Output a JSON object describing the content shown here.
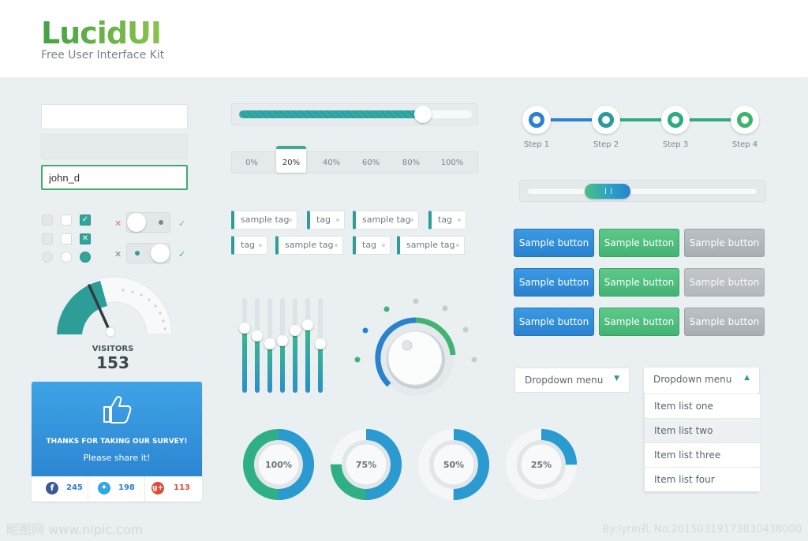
{
  "brand": {
    "logo_text": "LucidUI",
    "tagline": "Free User Interface Kit"
  },
  "inputs": {
    "empty_value": "",
    "disabled_value": "",
    "active_value": "john_d"
  },
  "progress": {
    "fill_fraction": 0.79
  },
  "segments": {
    "labels": [
      "0%",
      "20%",
      "40%",
      "60%",
      "80%",
      "100%"
    ],
    "selected": "20%"
  },
  "tags": {
    "row1": [
      "sample tag",
      "tag",
      "sample tag",
      "tag"
    ],
    "row2": [
      "tag",
      "sample tag",
      "tag",
      "sample tag"
    ]
  },
  "stepper": {
    "steps": [
      "Step 1",
      "Step 2",
      "Step 3",
      "Step 4"
    ]
  },
  "range_slider": {
    "low": 0.25,
    "high": 0.45
  },
  "buttons": {
    "label": "Sample button"
  },
  "gauge": {
    "label": "VISITORS",
    "value": "153"
  },
  "survey": {
    "title": "THANKS FOR TAKING OUR SURVEY!",
    "subtitle": "Please share it!",
    "facebook": "245",
    "twitter": "198",
    "googleplus": "113"
  },
  "equalizer": {
    "levels": [
      0.68,
      0.6,
      0.52,
      0.55,
      0.66,
      0.72,
      0.52
    ]
  },
  "donuts": [
    {
      "label": "100%",
      "value": 100
    },
    {
      "label": "75%",
      "value": 75
    },
    {
      "label": "50%",
      "value": 50
    },
    {
      "label": "25%",
      "value": 25
    }
  ],
  "dropdowns": {
    "closed": "Dropdown menu",
    "open": "Dropdown menu",
    "items": [
      "Item list one",
      "Item list two",
      "Item list three",
      "Item list four"
    ]
  },
  "watermark": {
    "left": "昵图网 www.nipic.com",
    "right": "By:lyrin孔 No.20150319173830438000"
  },
  "colors": {
    "teal": "#2d9e97",
    "green": "#43b373",
    "blue": "#2a82cf",
    "gray": "#a9aeb2"
  }
}
